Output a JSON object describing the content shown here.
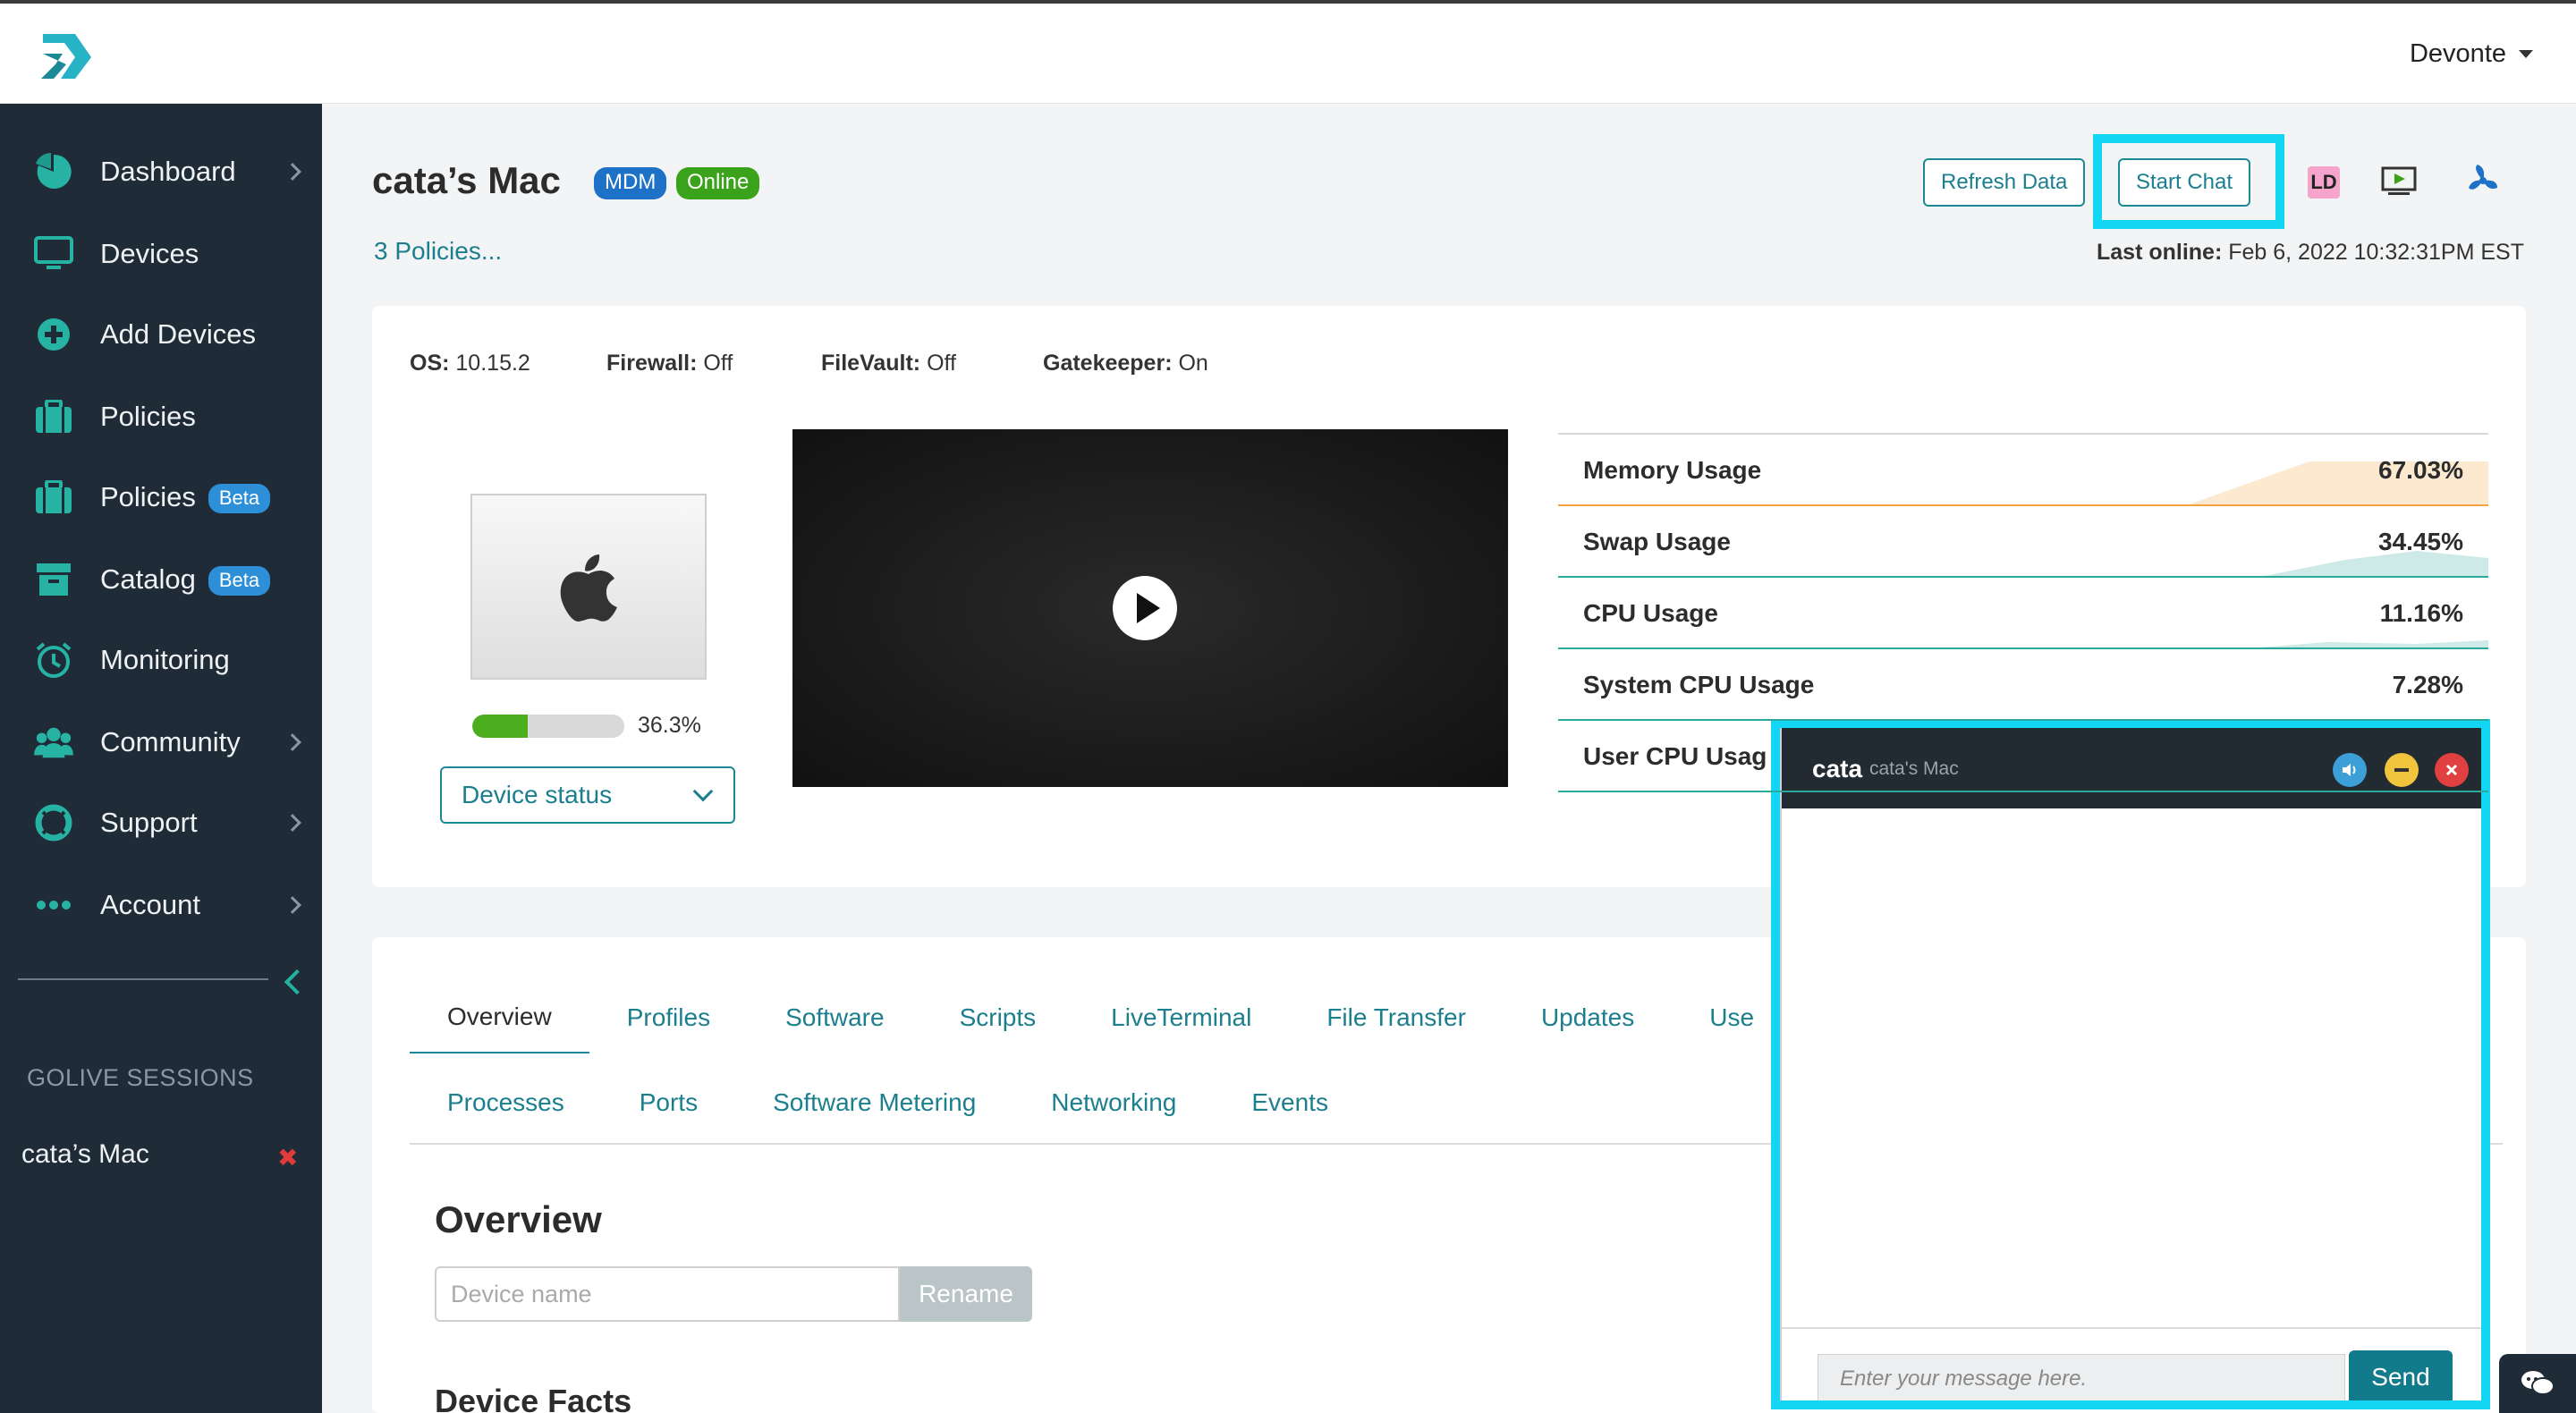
{
  "user": {
    "name": "Devonte"
  },
  "sidebar": {
    "items": [
      {
        "label": "Dashboard"
      },
      {
        "label": "Devices"
      },
      {
        "label": "Add Devices"
      },
      {
        "label": "Policies"
      },
      {
        "label": "Policies",
        "badge": "Beta"
      },
      {
        "label": "Catalog",
        "badge": "Beta"
      },
      {
        "label": "Monitoring"
      },
      {
        "label": "Community"
      },
      {
        "label": "Support"
      },
      {
        "label": "Account"
      }
    ],
    "golive_heading": "GOLIVE SESSIONS",
    "golive_session": "cata’s Mac",
    "golive_close": "✖"
  },
  "device": {
    "title": "cata’s Mac",
    "badge_mdm": "MDM",
    "badge_online": "Online",
    "policies_link": "3 Policies...",
    "last_online_label": "Last online:",
    "last_online_value": "Feb 6, 2022 10:32:31PM EST",
    "specs": [
      {
        "label": "OS:",
        "value": "10.15.2"
      },
      {
        "label": "Firewall:",
        "value": "Off"
      },
      {
        "label": "FileVault:",
        "value": "Off"
      },
      {
        "label": "Gatekeeper:",
        "value": "On"
      }
    ],
    "disk_pct_value": 36.3,
    "disk_pct_text": "36.3%",
    "status_select": "Device status"
  },
  "actions": {
    "refresh": "Refresh Data",
    "start_chat": "Start Chat",
    "ld": "LD"
  },
  "metrics": [
    {
      "name": "Memory Usage",
      "value": "67.03%",
      "color": "#f5a142",
      "fill": "#fde9cf"
    },
    {
      "name": "Swap Usage",
      "value": "34.45%",
      "color": "#2aa89a",
      "fill": "#cdeae6"
    },
    {
      "name": "CPU Usage",
      "value": "11.16%",
      "color": "#2aa89a",
      "fill": "#cdeae6"
    },
    {
      "name": "System CPU Usage",
      "value": "7.28%",
      "color": "#2aa89a",
      "fill": "#cdeae6"
    },
    {
      "name": "User CPU Usag",
      "value": "",
      "color": "#2aa89a",
      "fill": "#cdeae6"
    }
  ],
  "tabs": {
    "row1": [
      "Overview",
      "Profiles",
      "Software",
      "Scripts",
      "LiveTerminal",
      "File Transfer",
      "Updates",
      "Use"
    ],
    "row2": [
      "Processes",
      "Ports",
      "Software Metering",
      "Networking",
      "Events"
    ]
  },
  "overview": {
    "title": "Overview",
    "name_placeholder": "Device name",
    "rename": "Rename",
    "facts_title": "Device Facts"
  },
  "chat": {
    "user": "cata",
    "device": "cata's Mac",
    "placeholder": "Enter your message here.",
    "send": "Send"
  },
  "colors": {
    "accent": "#1b8a96",
    "highlight": "#12d6f4",
    "sidebar": "#1f2c37"
  }
}
